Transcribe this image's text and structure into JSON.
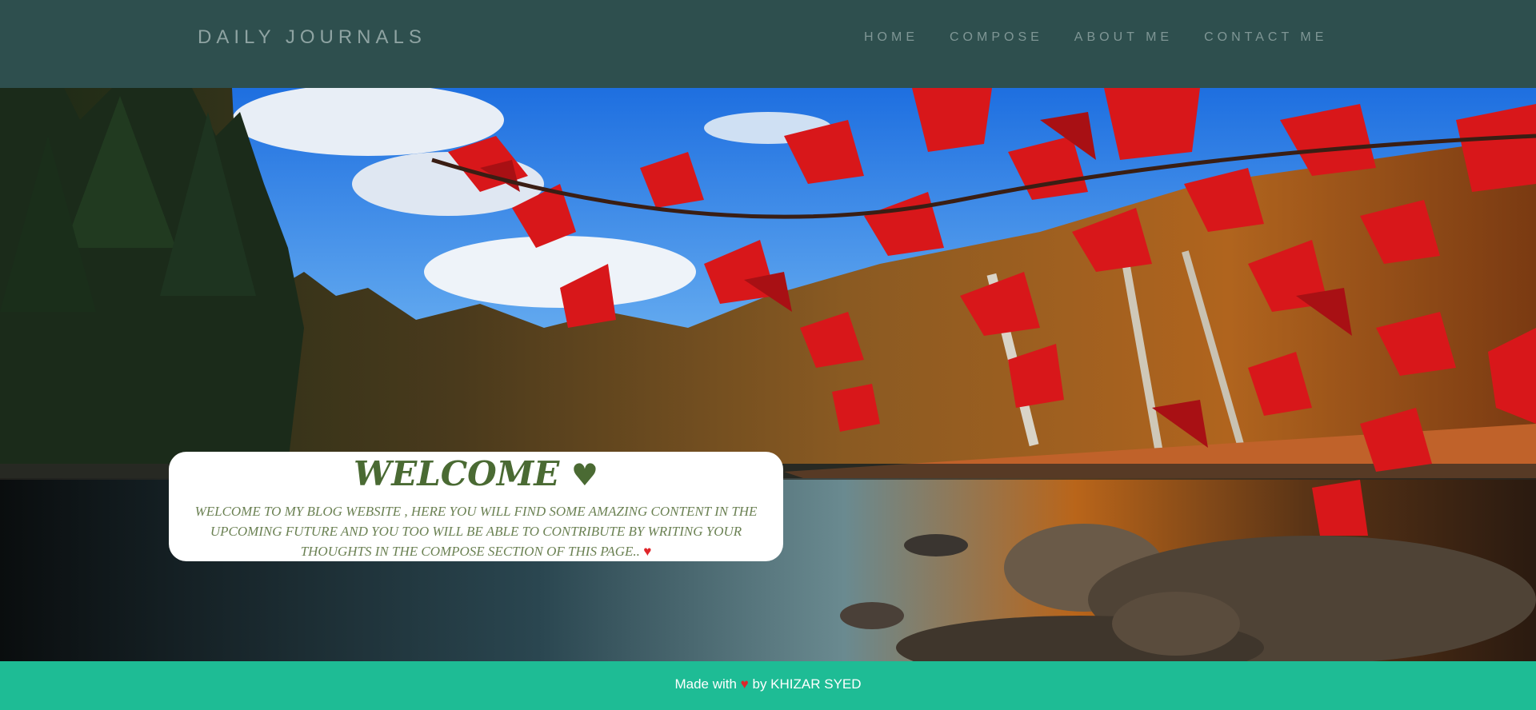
{
  "brand": {
    "title": "DAILY JOURNALS"
  },
  "nav": {
    "items": [
      {
        "label": "HOME"
      },
      {
        "label": "COMPOSE"
      },
      {
        "label": "ABOUT ME"
      },
      {
        "label": "CONTACT ME"
      }
    ]
  },
  "hero": {
    "welcome_title": "WELCOME",
    "welcome_heart": "♥",
    "welcome_text": "WELCOME TO MY BLOG WEBSITE , HERE YOU WILL FIND SOME AMAZING CONTENT IN THE UPCOMING FUTURE AND YOU TOO WILL BE ABLE TO CONTRIBUTE BY WRITING YOUR THOUGHTS IN THE COMPOSE SECTION OF THIS PAGE..",
    "text_heart": "♥"
  },
  "footer": {
    "prefix": "Made with",
    "heart": "♥",
    "suffix": "by KHIZAR SYED"
  },
  "colors": {
    "navbar_bg": "#2e4f4e",
    "footer_bg": "#1ebc95",
    "heart_red": "#e0262b",
    "welcome_green": "#4a6a33"
  }
}
